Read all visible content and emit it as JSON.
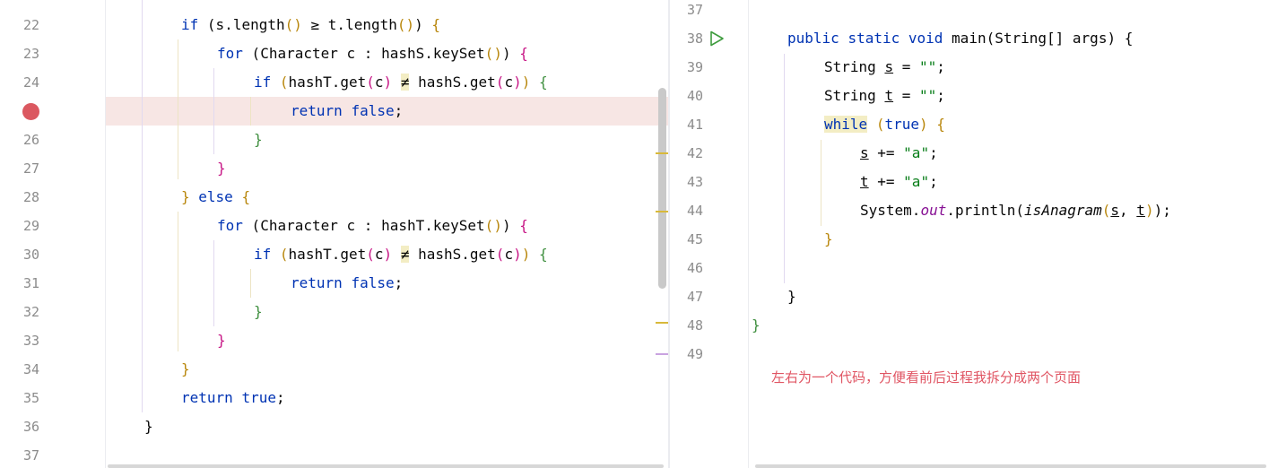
{
  "left_editor": {
    "lines": [
      {
        "n": "22"
      },
      {
        "n": "23"
      },
      {
        "n": "24"
      },
      {
        "n": "25"
      },
      {
        "n": "26"
      },
      {
        "n": "27"
      },
      {
        "n": "28"
      },
      {
        "n": "29"
      },
      {
        "n": "30"
      },
      {
        "n": "31"
      },
      {
        "n": "32"
      },
      {
        "n": "33"
      },
      {
        "n": "34"
      },
      {
        "n": "35"
      },
      {
        "n": "36"
      },
      {
        "n": "37"
      }
    ],
    "breakpoint_line": "25"
  },
  "right_editor": {
    "lines": [
      {
        "n": "37"
      },
      {
        "n": "38"
      },
      {
        "n": "39"
      },
      {
        "n": "40"
      },
      {
        "n": "41"
      },
      {
        "n": "42"
      },
      {
        "n": "43"
      },
      {
        "n": "44"
      },
      {
        "n": "45"
      },
      {
        "n": "46"
      },
      {
        "n": "47"
      },
      {
        "n": "48"
      },
      {
        "n": "49"
      }
    ]
  },
  "tokens": {
    "if": "if",
    "for": "for",
    "else": "else",
    "return": "return",
    "false": "false",
    "true": "true",
    "public": "public",
    "static": "static",
    "void": "void",
    "while": "while",
    "s": "s",
    "t": "t",
    "c": "c",
    "lp": "(",
    "rp": ")",
    "lb": "{",
    "rb": "}",
    "brk": "[]",
    "length_call": "s.length",
    "ge": " ≥ ",
    "t_length": "t.length",
    "character": "Character",
    "colon": " : ",
    "hashS_keyset": "hashS.keySet",
    "hashT_keyset": "hashT.keySet",
    "hashT_get": "hashT.get",
    "hashS_get": "hashS.get",
    "ne": "≠",
    "semi": ";",
    "main": "main",
    "string": "String",
    "args": " args",
    "eq_empty": " = ",
    "empty_str": "\"\"",
    "plus_eq": " += ",
    "a_str": "\"a\"",
    "system": "System.",
    "out": "out",
    "println": ".println",
    "isAnagram": "isAnagram",
    "comma": ", "
  },
  "annotation": "左右为一个代码，方便看前后过程我拆分成两个页面",
  "colors": {
    "keyword": "#0033b3",
    "string": "#067d17",
    "breakpoint": "#db5860",
    "breakpoint_line_bg": "#f7e6e4",
    "annotation": "#e05563"
  }
}
